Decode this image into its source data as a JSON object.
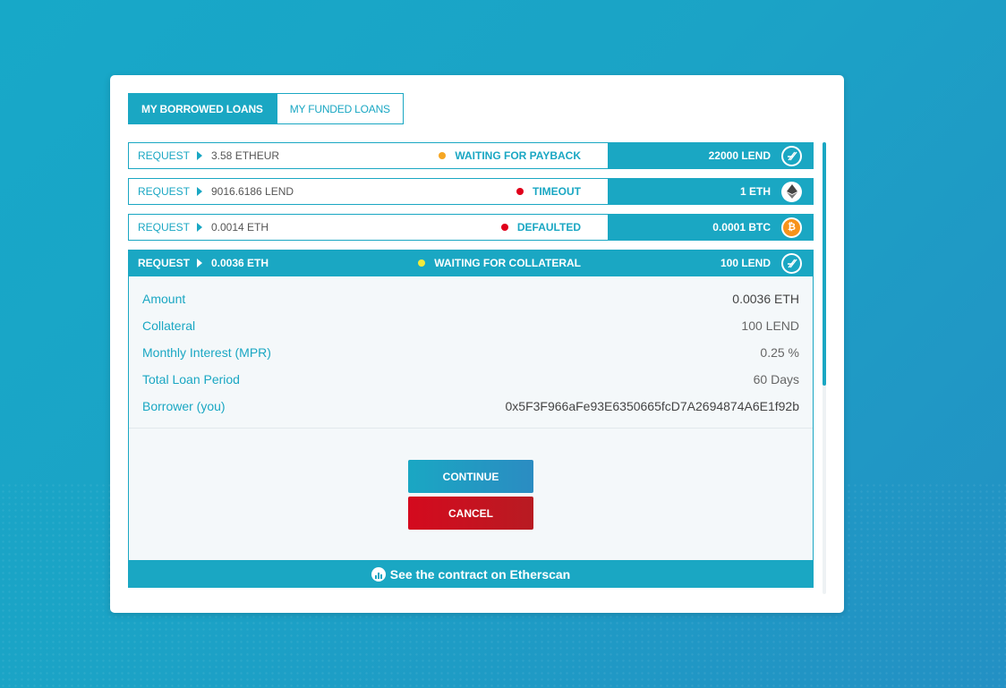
{
  "tabs": [
    {
      "label": "MY BORROWED LOANS",
      "active": true
    },
    {
      "label": "MY FUNDED LOANS",
      "active": false
    }
  ],
  "loans": [
    {
      "request_label": "REQUEST",
      "amount": "3.58 ETHEUR",
      "status": "WAITING FOR PAYBACK",
      "status_color": "#f5a623",
      "collateral": "22000 LEND",
      "coin_icon": "lend-icon"
    },
    {
      "request_label": "REQUEST",
      "amount": "9016.6186 LEND",
      "status": "TIMEOUT",
      "status_color": "#e0001b",
      "collateral": "1 ETH",
      "coin_icon": "eth-icon"
    },
    {
      "request_label": "REQUEST",
      "amount": "0.0014 ETH",
      "status": "DEFAULTED",
      "status_color": "#e0001b",
      "collateral": "0.0001 BTC",
      "coin_icon": "btc-icon"
    },
    {
      "request_label": "REQUEST",
      "amount": "0.0036 ETH",
      "status": "WAITING FOR COLLATERAL",
      "status_color": "#f2ea3a",
      "collateral": "100 LEND",
      "coin_icon": "lend-icon"
    }
  ],
  "details": {
    "amount": {
      "label": "Amount",
      "value": "0.0036 ETH"
    },
    "collateral": {
      "label": "Collateral",
      "value": "100 LEND"
    },
    "interest": {
      "label": "Monthly Interest (MPR)",
      "value": "0.25 %"
    },
    "period": {
      "label": "Total Loan Period",
      "value": "60 Days"
    },
    "borrower": {
      "label": "Borrower (you)",
      "value": "0x5F3F966aFe93E6350665fcD7A2694874A6E1f92b"
    }
  },
  "buttons": {
    "continue": "CONTINUE",
    "cancel": "CANCEL"
  },
  "footer": {
    "link_text": "See the contract on Etherscan"
  },
  "btc_symbol": "₿"
}
